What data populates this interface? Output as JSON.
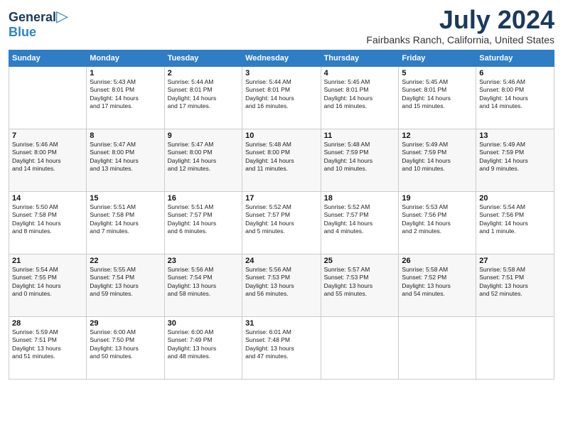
{
  "header": {
    "logo_general": "General",
    "logo_blue": "Blue",
    "month_title": "July 2024",
    "location": "Fairbanks Ranch, California, United States"
  },
  "weekdays": [
    "Sunday",
    "Monday",
    "Tuesday",
    "Wednesday",
    "Thursday",
    "Friday",
    "Saturday"
  ],
  "weeks": [
    [
      {
        "day": "",
        "info": ""
      },
      {
        "day": "1",
        "info": "Sunrise: 5:43 AM\nSunset: 8:01 PM\nDaylight: 14 hours\nand 17 minutes."
      },
      {
        "day": "2",
        "info": "Sunrise: 5:44 AM\nSunset: 8:01 PM\nDaylight: 14 hours\nand 17 minutes."
      },
      {
        "day": "3",
        "info": "Sunrise: 5:44 AM\nSunset: 8:01 PM\nDaylight: 14 hours\nand 16 minutes."
      },
      {
        "day": "4",
        "info": "Sunrise: 5:45 AM\nSunset: 8:01 PM\nDaylight: 14 hours\nand 16 minutes."
      },
      {
        "day": "5",
        "info": "Sunrise: 5:45 AM\nSunset: 8:01 PM\nDaylight: 14 hours\nand 15 minutes."
      },
      {
        "day": "6",
        "info": "Sunrise: 5:46 AM\nSunset: 8:00 PM\nDaylight: 14 hours\nand 14 minutes."
      }
    ],
    [
      {
        "day": "7",
        "info": "Sunrise: 5:46 AM\nSunset: 8:00 PM\nDaylight: 14 hours\nand 14 minutes."
      },
      {
        "day": "8",
        "info": "Sunrise: 5:47 AM\nSunset: 8:00 PM\nDaylight: 14 hours\nand 13 minutes."
      },
      {
        "day": "9",
        "info": "Sunrise: 5:47 AM\nSunset: 8:00 PM\nDaylight: 14 hours\nand 12 minutes."
      },
      {
        "day": "10",
        "info": "Sunrise: 5:48 AM\nSunset: 8:00 PM\nDaylight: 14 hours\nand 11 minutes."
      },
      {
        "day": "11",
        "info": "Sunrise: 5:48 AM\nSunset: 7:59 PM\nDaylight: 14 hours\nand 10 minutes."
      },
      {
        "day": "12",
        "info": "Sunrise: 5:49 AM\nSunset: 7:59 PM\nDaylight: 14 hours\nand 10 minutes."
      },
      {
        "day": "13",
        "info": "Sunrise: 5:49 AM\nSunset: 7:59 PM\nDaylight: 14 hours\nand 9 minutes."
      }
    ],
    [
      {
        "day": "14",
        "info": "Sunrise: 5:50 AM\nSunset: 7:58 PM\nDaylight: 14 hours\nand 8 minutes."
      },
      {
        "day": "15",
        "info": "Sunrise: 5:51 AM\nSunset: 7:58 PM\nDaylight: 14 hours\nand 7 minutes."
      },
      {
        "day": "16",
        "info": "Sunrise: 5:51 AM\nSunset: 7:57 PM\nDaylight: 14 hours\nand 6 minutes."
      },
      {
        "day": "17",
        "info": "Sunrise: 5:52 AM\nSunset: 7:57 PM\nDaylight: 14 hours\nand 5 minutes."
      },
      {
        "day": "18",
        "info": "Sunrise: 5:52 AM\nSunset: 7:57 PM\nDaylight: 14 hours\nand 4 minutes."
      },
      {
        "day": "19",
        "info": "Sunrise: 5:53 AM\nSunset: 7:56 PM\nDaylight: 14 hours\nand 2 minutes."
      },
      {
        "day": "20",
        "info": "Sunrise: 5:54 AM\nSunset: 7:56 PM\nDaylight: 14 hours\nand 1 minute."
      }
    ],
    [
      {
        "day": "21",
        "info": "Sunrise: 5:54 AM\nSunset: 7:55 PM\nDaylight: 14 hours\nand 0 minutes."
      },
      {
        "day": "22",
        "info": "Sunrise: 5:55 AM\nSunset: 7:54 PM\nDaylight: 13 hours\nand 59 minutes."
      },
      {
        "day": "23",
        "info": "Sunrise: 5:56 AM\nSunset: 7:54 PM\nDaylight: 13 hours\nand 58 minutes."
      },
      {
        "day": "24",
        "info": "Sunrise: 5:56 AM\nSunset: 7:53 PM\nDaylight: 13 hours\nand 56 minutes."
      },
      {
        "day": "25",
        "info": "Sunrise: 5:57 AM\nSunset: 7:53 PM\nDaylight: 13 hours\nand 55 minutes."
      },
      {
        "day": "26",
        "info": "Sunrise: 5:58 AM\nSunset: 7:52 PM\nDaylight: 13 hours\nand 54 minutes."
      },
      {
        "day": "27",
        "info": "Sunrise: 5:58 AM\nSunset: 7:51 PM\nDaylight: 13 hours\nand 52 minutes."
      }
    ],
    [
      {
        "day": "28",
        "info": "Sunrise: 5:59 AM\nSunset: 7:51 PM\nDaylight: 13 hours\nand 51 minutes."
      },
      {
        "day": "29",
        "info": "Sunrise: 6:00 AM\nSunset: 7:50 PM\nDaylight: 13 hours\nand 50 minutes."
      },
      {
        "day": "30",
        "info": "Sunrise: 6:00 AM\nSunset: 7:49 PM\nDaylight: 13 hours\nand 48 minutes."
      },
      {
        "day": "31",
        "info": "Sunrise: 6:01 AM\nSunset: 7:48 PM\nDaylight: 13 hours\nand 47 minutes."
      },
      {
        "day": "",
        "info": ""
      },
      {
        "day": "",
        "info": ""
      },
      {
        "day": "",
        "info": ""
      }
    ]
  ]
}
